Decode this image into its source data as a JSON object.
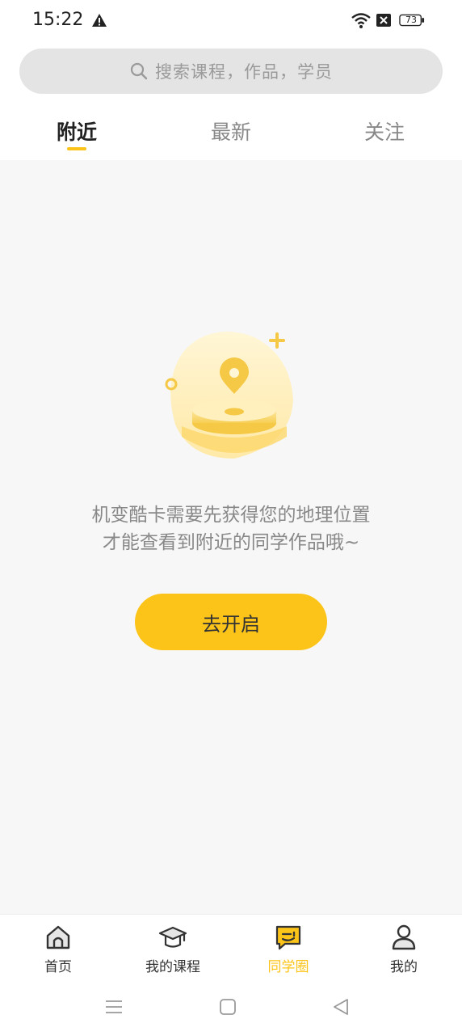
{
  "status_bar": {
    "time": "15:22",
    "battery": "73"
  },
  "search": {
    "placeholder": "搜索课程，作品，学员"
  },
  "tabs": [
    {
      "label": "附近",
      "active": true
    },
    {
      "label": "最新",
      "active": false
    },
    {
      "label": "关注",
      "active": false
    }
  ],
  "empty_state": {
    "icon": "location-pin-icon",
    "line1": "机变酷卡需要先获得您的地理位置",
    "line2": "才能查看到附近的同学作品哦~",
    "button_label": "去开启"
  },
  "bottom_nav": [
    {
      "label": "首页",
      "icon": "home-icon",
      "active": false
    },
    {
      "label": "我的课程",
      "icon": "graduation-cap-icon",
      "active": false
    },
    {
      "label": "同学圈",
      "icon": "chat-icon",
      "active": true
    },
    {
      "label": "我的",
      "icon": "user-icon",
      "active": false
    }
  ],
  "colors": {
    "accent": "#fcc419",
    "background": "#f7f7f7"
  }
}
